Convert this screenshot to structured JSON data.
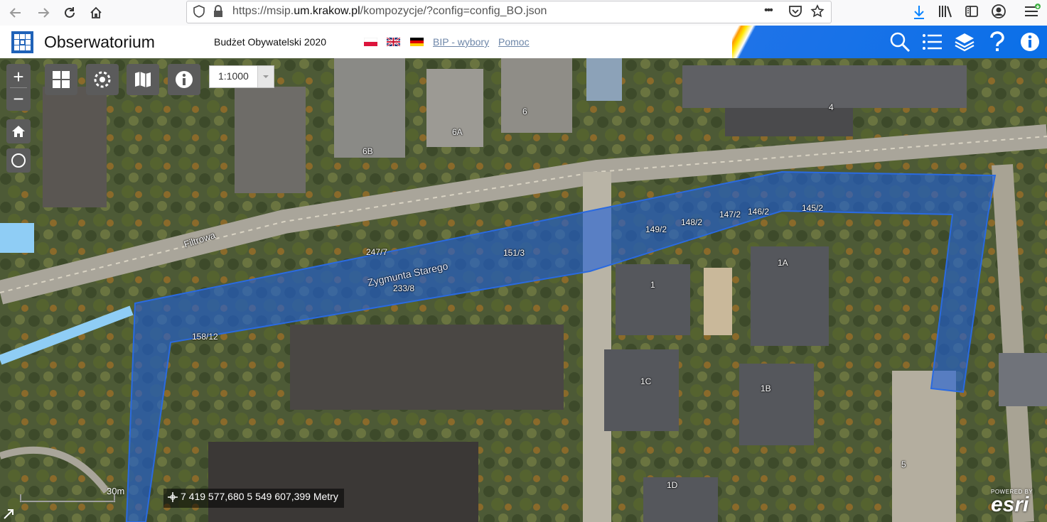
{
  "browser": {
    "url_prefix": "https://msip.",
    "url_domain": "um.krakow.pl",
    "url_rest": "/kompozycje/?config=config_BO.json",
    "more_label": "•••"
  },
  "header": {
    "app_title": "Obserwatorium",
    "subtitle": "Budżet Obywatelski 2020",
    "links": [
      "BIP - wybory",
      "Pomoc"
    ],
    "flags": [
      "pl",
      "gb",
      "de"
    ],
    "accent_color": "#0a6fe8",
    "icons": [
      "search-icon",
      "list-icon",
      "layers-icon",
      "help-icon",
      "info-icon"
    ]
  },
  "map": {
    "zoom_in": "+",
    "zoom_out": "−",
    "scale_value": "1:1000",
    "scalebar_label": "30m",
    "coordinates": "7 419 577,680 5 549 607,399 Metry",
    "attribution_small": "POWERED BY",
    "attribution_logo": "esri",
    "highlight_color": "#1e5fd6",
    "street_labels": [
      "Filtrowa",
      "Zygmunta Starego"
    ],
    "parcel_labels": [
      "247/7",
      "151/3",
      "149/2",
      "148/2",
      "147/2",
      "146/2",
      "145/2",
      "233/8",
      "158/12"
    ],
    "building_labels": [
      "6B",
      "6A",
      "6",
      "4",
      "1A",
      "1",
      "1C",
      "1B",
      "1D",
      "5"
    ]
  }
}
